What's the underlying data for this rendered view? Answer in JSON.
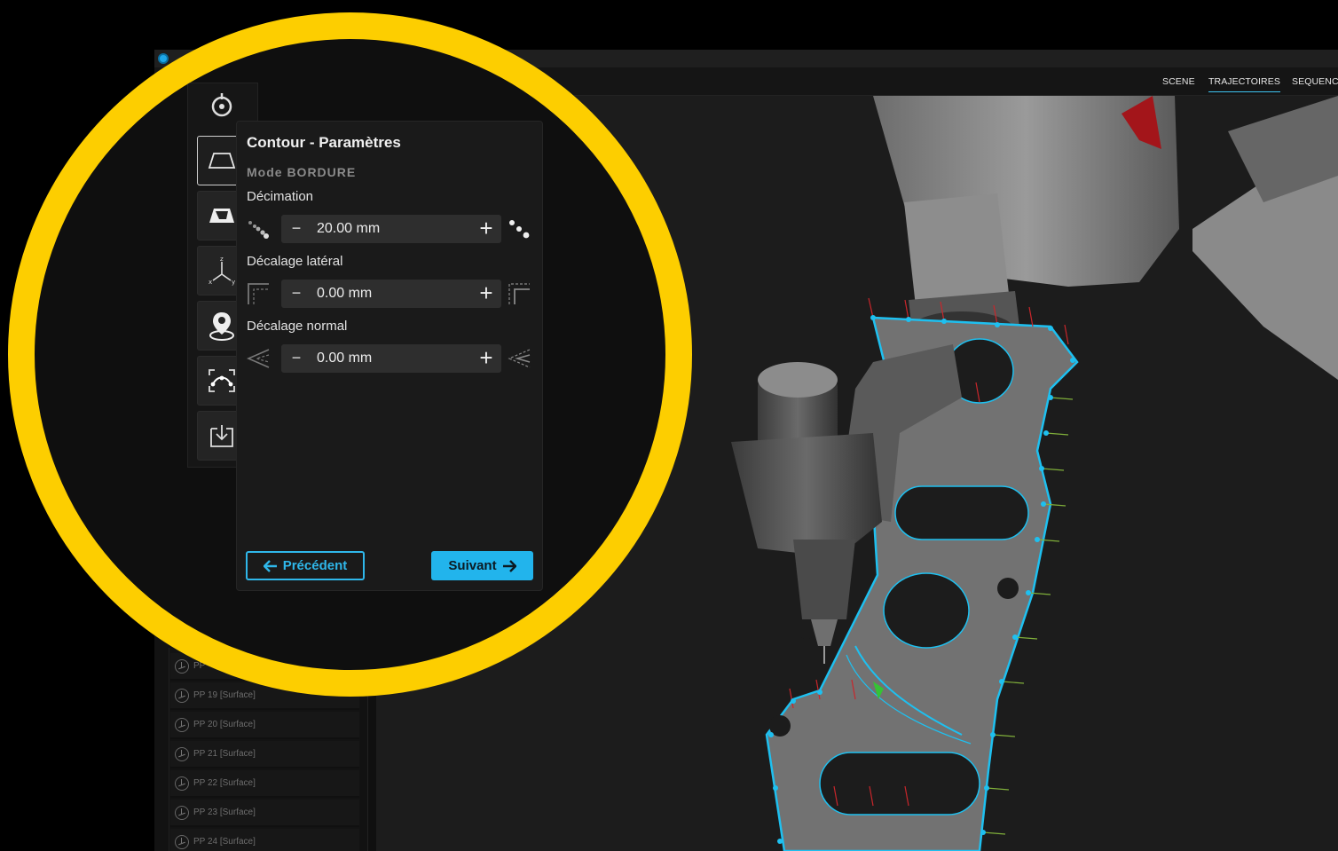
{
  "topnav": {
    "tabs": [
      {
        "label": "SCENE",
        "active": false
      },
      {
        "label": "TRAJECTOIRES",
        "active": true
      },
      {
        "label": "SEQUENC",
        "active": false
      }
    ]
  },
  "toolbar": {
    "tools": [
      {
        "name": "target-tool",
        "icon": "target-icon",
        "active": false
      },
      {
        "name": "contour-tool",
        "icon": "trapezoid-outline-icon",
        "active": true
      },
      {
        "name": "surface-tool",
        "icon": "trapezoid-filled-icon",
        "active": false
      },
      {
        "name": "axes-tool",
        "icon": "xyz-axes-icon",
        "active": false
      },
      {
        "name": "location-tool",
        "icon": "map-pin-icon",
        "active": false
      },
      {
        "name": "fit-tool",
        "icon": "curve-fit-icon",
        "active": false
      },
      {
        "name": "export-tool",
        "icon": "download-icon",
        "active": false
      }
    ]
  },
  "params": {
    "title": "Contour - Paramètres",
    "mode": "Mode BORDURE",
    "decimation": {
      "label": "Décimation",
      "value": "20.00 mm"
    },
    "lateral_offset": {
      "label": "Décalage latéral",
      "value": "0.00 mm"
    },
    "normal_offset": {
      "label": "Décalage normal",
      "value": "0.00 mm"
    },
    "minus": "−",
    "plus": "+",
    "prev_label": "Précédent",
    "next_label": "Suivant"
  },
  "list": {
    "items": [
      {
        "label": "PP"
      },
      {
        "label": "PP 19 [Surface]"
      },
      {
        "label": "PP 20 [Surface]"
      },
      {
        "label": "PP 21 [Surface]"
      },
      {
        "label": "PP 22 [Surface]"
      },
      {
        "label": "PP 23 [Surface]"
      },
      {
        "label": "PP 24 [Surface]"
      }
    ]
  },
  "colors": {
    "highlight_ring": "#fdce00",
    "accent": "#22b4ec",
    "trajectory": "#1ec0f0"
  }
}
